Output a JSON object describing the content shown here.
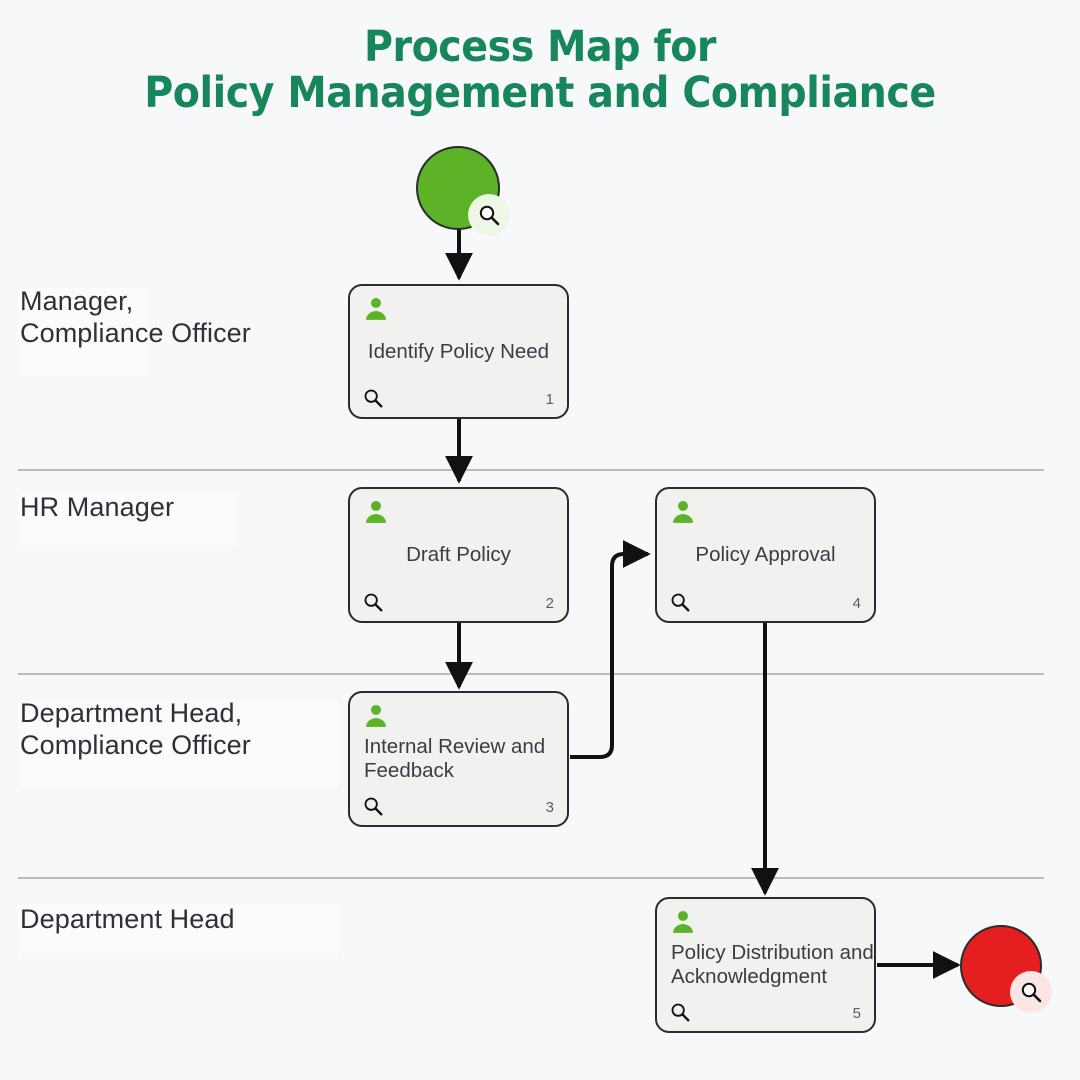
{
  "title": {
    "line1": "Process Map for",
    "line2": "Policy Management and Compliance",
    "color": "#17865a"
  },
  "colors": {
    "background": "#f6f8fa",
    "start_node": "#5cb327",
    "end_node": "#e51f1f",
    "task_fill": "#f1f1f0",
    "task_stroke": "#2b2b2b",
    "person_icon": "#5cb327",
    "lane_divider": "#b9bcc0",
    "text": "#3a3d41"
  },
  "lanes": [
    {
      "id": "lane-1",
      "label": "Manager,\nCompliance Officer"
    },
    {
      "id": "lane-2",
      "label": "HR Manager"
    },
    {
      "id": "lane-3",
      "label": "Department Head,\nCompliance Officer"
    },
    {
      "id": "lane-4",
      "label": "Department Head"
    }
  ],
  "nodes": {
    "start": {
      "type": "start-event",
      "icon": "magnifier-badge-icon"
    },
    "end": {
      "type": "end-event",
      "icon": "magnifier-badge-icon"
    },
    "tasks": [
      {
        "id": "task-1",
        "label": "Identify Policy Need",
        "number": "1",
        "lane": "lane-1",
        "align": "center"
      },
      {
        "id": "task-2",
        "label": "Draft Policy",
        "number": "2",
        "lane": "lane-2",
        "align": "center"
      },
      {
        "id": "task-3",
        "label": "Internal Review and\nFeedback",
        "number": "3",
        "lane": "lane-3",
        "align": "left"
      },
      {
        "id": "task-4",
        "label": "Policy Approval",
        "number": "4",
        "lane": "lane-2",
        "align": "center"
      },
      {
        "id": "task-5",
        "label": "Policy Distribution and\nAcknowledgment",
        "number": "5",
        "lane": "lane-4",
        "align": "left"
      }
    ]
  },
  "flows": [
    {
      "from": "start",
      "to": "task-1"
    },
    {
      "from": "task-1",
      "to": "task-2"
    },
    {
      "from": "task-2",
      "to": "task-3"
    },
    {
      "from": "task-3",
      "to": "task-4"
    },
    {
      "from": "task-4",
      "to": "task-5"
    },
    {
      "from": "task-5",
      "to": "end"
    }
  ]
}
